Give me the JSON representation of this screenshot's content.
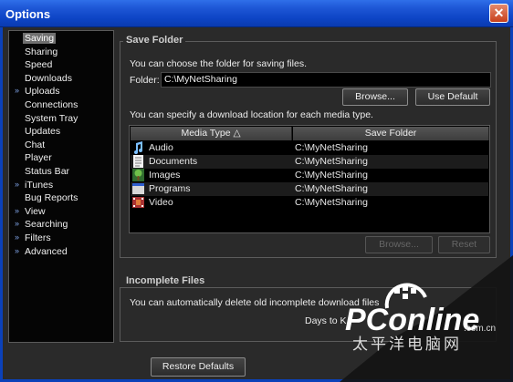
{
  "window": {
    "title": "Options"
  },
  "sidebar": {
    "items": [
      {
        "label": "Saving",
        "expandable": false,
        "selected": true
      },
      {
        "label": "Sharing",
        "expandable": false
      },
      {
        "label": "Speed",
        "expandable": false
      },
      {
        "label": "Downloads",
        "expandable": false
      },
      {
        "label": "Uploads",
        "expandable": true
      },
      {
        "label": "Connections",
        "expandable": false
      },
      {
        "label": "System Tray",
        "expandable": false
      },
      {
        "label": "Updates",
        "expandable": false
      },
      {
        "label": "Chat",
        "expandable": false
      },
      {
        "label": "Player",
        "expandable": false
      },
      {
        "label": "Status Bar",
        "expandable": false
      },
      {
        "label": "iTunes",
        "expandable": true
      },
      {
        "label": "Bug Reports",
        "expandable": false
      },
      {
        "label": "View",
        "expandable": true
      },
      {
        "label": "Searching",
        "expandable": true
      },
      {
        "label": "Filters",
        "expandable": true
      },
      {
        "label": "Advanced",
        "expandable": true
      }
    ]
  },
  "save_folder": {
    "title": "Save Folder",
    "description": "You can choose the folder for saving files.",
    "folder_label": "Folder:",
    "folder_value": "C:\\MyNetSharing",
    "browse_label": "Browse...",
    "use_default_label": "Use Default",
    "media_description": "You can specify a download location for each media type.",
    "table": {
      "columns": [
        "Media Type △",
        "Save Folder"
      ],
      "rows": [
        {
          "name": "Audio",
          "path": "C:\\MyNetSharing",
          "icon": "audio-icon"
        },
        {
          "name": "Documents",
          "path": "C:\\MyNetSharing",
          "icon": "document-icon"
        },
        {
          "name": "Images",
          "path": "C:\\MyNetSharing",
          "icon": "image-icon"
        },
        {
          "name": "Programs",
          "path": "C:\\MyNetSharing",
          "icon": "program-icon"
        },
        {
          "name": "Video",
          "path": "C:\\MyNetSharing",
          "icon": "video-icon"
        }
      ]
    },
    "table_browse_label": "Browse...",
    "table_reset_label": "Reset"
  },
  "incomplete": {
    "title": "Incomplete Files",
    "description": "You can automatically delete old incomplete download files",
    "days_label": "Days to K"
  },
  "footer": {
    "restore_label": "Restore Defaults"
  },
  "watermark": {
    "brand": "PConline",
    "domain": ".com.cn",
    "tagline": "太平洋电脑网"
  },
  "colors": {
    "titlebar": "#0d44c5",
    "panel": "#2a2a2a",
    "close": "#c8401c"
  }
}
